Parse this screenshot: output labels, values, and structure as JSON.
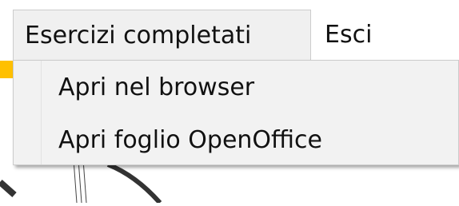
{
  "menubar": {
    "items": [
      {
        "label": "Esercizi completati",
        "state": "open"
      },
      {
        "label": "Esci",
        "state": "closed"
      }
    ]
  },
  "dropdown": {
    "items": [
      {
        "label": "Apri nel browser"
      },
      {
        "label": "Apri foglio OpenOffice"
      }
    ]
  },
  "colors": {
    "menubar_bg": "#ffffff",
    "menu_open_bg": "#f0f0f0",
    "dropdown_bg": "#f2f2f2",
    "border": "#cccccc",
    "accent_strip": "#ffc000",
    "text": "#111111"
  }
}
